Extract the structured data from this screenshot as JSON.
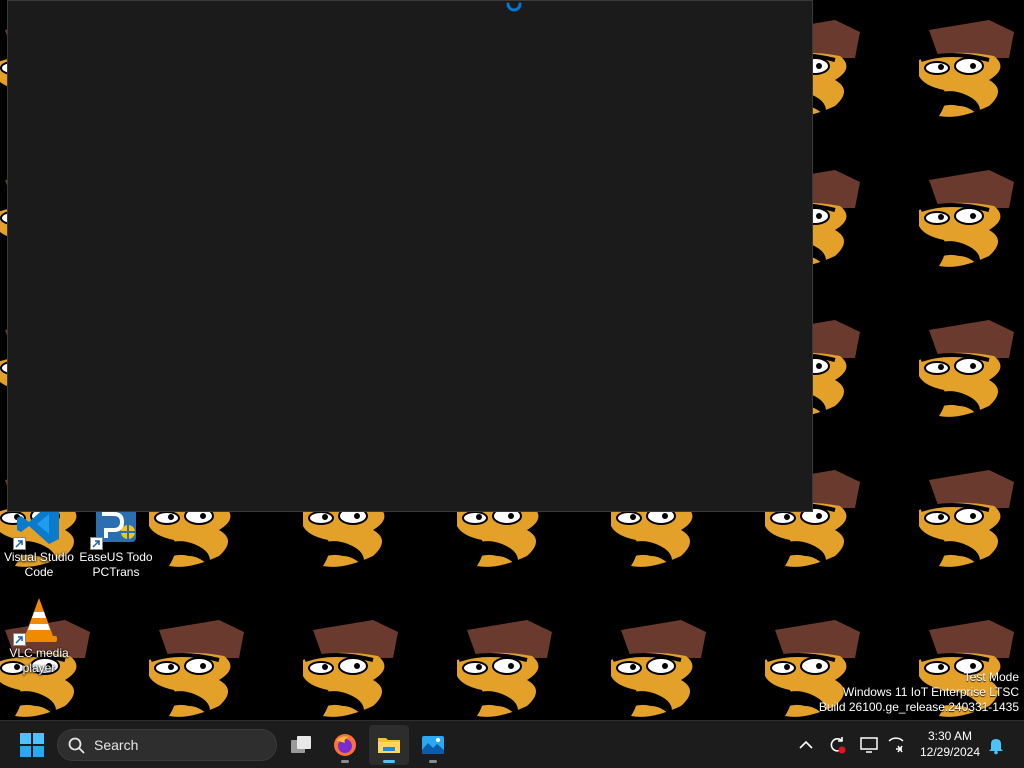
{
  "desktop": {
    "icons": [
      {
        "label_line1": "Visual Studio",
        "label_line2": "Code",
        "icon": "vscode-icon"
      },
      {
        "label_line1": "EaseUS Todo",
        "label_line2": "PCTrans",
        "icon": "easeus-icon"
      },
      {
        "label_line1": "VLC media",
        "label_line2": "player",
        "icon": "vlc-icon"
      }
    ],
    "watermark": {
      "line1": "Test Mode",
      "line2": "Windows 11 IoT Enterprise LTSC",
      "line3": "Build 26100.ge_release.240331-1435"
    }
  },
  "window": {
    "state": "loading",
    "spinner_color": "#0078d4",
    "background": "#1b1b1b"
  },
  "taskbar": {
    "search_label": "Search",
    "apps": [
      {
        "icon": "task-view-icon"
      },
      {
        "icon": "firefox-icon",
        "running": true
      },
      {
        "icon": "file-explorer-icon",
        "running": true,
        "active": true
      },
      {
        "icon": "photos-icon",
        "running": true
      }
    ],
    "tray": [
      "chevron-up-icon",
      "sync-error-icon",
      "display-icon",
      "network-off-icon"
    ],
    "clock": {
      "time": "3:30 AM",
      "date": "12/29/2024"
    },
    "accent": "#4cc2ff"
  }
}
